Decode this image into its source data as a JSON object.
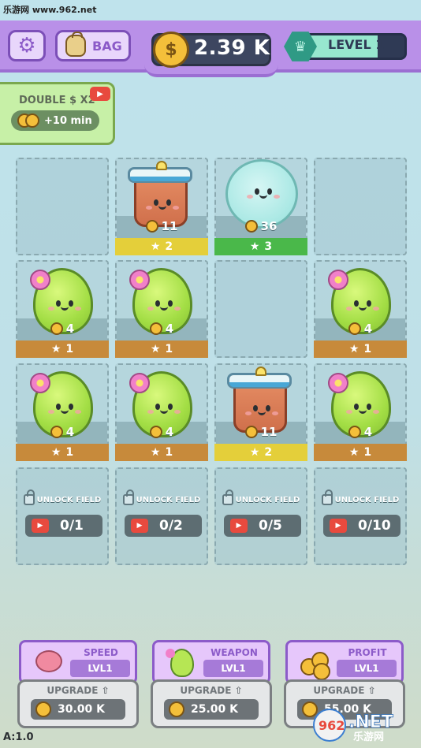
{
  "watermark": {
    "top": "乐游网 www.962.net",
    "brand_big": "962.NET",
    "brand_small": "乐游网"
  },
  "header": {
    "settings_icon": "gear-icon",
    "bag_label": "BAG",
    "bag_icon": "backpack-icon",
    "money": "2.39 K",
    "coin_symbol": "$",
    "level_label": "LEVEL 1",
    "level_progress": 0.75,
    "colors": {
      "bar": "#b990e8",
      "money_bg": "#3d4660",
      "level_fill": "#97e7cf"
    }
  },
  "double_panel": {
    "label": "DOUBLE $ X2",
    "time": "+10 min",
    "ad_icon": "video-ad-icon"
  },
  "grid": {
    "rows": [
      [
        {
          "type": "empty"
        },
        {
          "type": "jar",
          "income": "11",
          "rank": "2"
        },
        {
          "type": "cookie",
          "income": "36",
          "rank": "3"
        },
        {
          "type": "empty"
        }
      ],
      [
        {
          "type": "blob",
          "income": "4",
          "rank": "1"
        },
        {
          "type": "blob",
          "income": "4",
          "rank": "1"
        },
        {
          "type": "empty"
        },
        {
          "type": "blob",
          "income": "4",
          "rank": "1"
        }
      ],
      [
        {
          "type": "blob",
          "income": "4",
          "rank": "1"
        },
        {
          "type": "blob",
          "income": "4",
          "rank": "1"
        },
        {
          "type": "jar",
          "income": "11",
          "rank": "2"
        },
        {
          "type": "blob",
          "income": "4",
          "rank": "1"
        }
      ],
      [
        {
          "type": "locked",
          "label": "UNLOCK FIELD",
          "count": "0/1"
        },
        {
          "type": "locked",
          "label": "UNLOCK FIELD",
          "count": "0/2"
        },
        {
          "type": "locked",
          "label": "UNLOCK FIELD",
          "count": "0/5"
        },
        {
          "type": "locked",
          "label": "UNLOCK FIELD",
          "count": "0/10"
        }
      ]
    ],
    "rank_colors": {
      "1": "#c78a3b",
      "2": "#e4cf3a",
      "3": "#4ab84a"
    }
  },
  "upgrades": [
    {
      "title": "SPEED",
      "level": "LVL1",
      "button": "UPGRADE",
      "price": "30.00 K",
      "icon": "running-creature-icon"
    },
    {
      "title": "WEAPON",
      "level": "LVL1",
      "button": "UPGRADE",
      "price": "25.00 K",
      "icon": "blob-creature-icon"
    },
    {
      "title": "PROFIT",
      "level": "LVL1",
      "button": "UPGRADE",
      "price": "55.00 K",
      "icon": "coin-stack-icon"
    }
  ],
  "version": "A:1.0"
}
